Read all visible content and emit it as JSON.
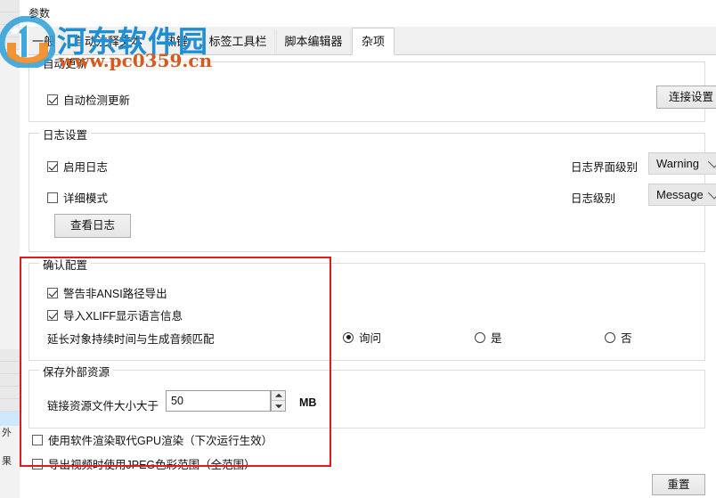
{
  "window": {
    "title": "参数"
  },
  "background_strip": {
    "rows": [
      "",
      "",
      "",
      "",
      "",
      "",
      "",
      "外",
      "果"
    ]
  },
  "tabs": [
    {
      "label": "一般",
      "active": false
    },
    {
      "label": "自动注释文本",
      "active": false
    },
    {
      "label": "热键",
      "active": false
    },
    {
      "label": "标签工具栏",
      "active": false
    },
    {
      "label": "脚本编辑器",
      "active": false
    },
    {
      "label": "杂项",
      "active": true
    }
  ],
  "auto_update": {
    "legend": "自动更新",
    "checkbox": {
      "label": "自动检测更新",
      "checked": true
    },
    "connection_button": "连接设置"
  },
  "log_settings": {
    "legend": "日志设置",
    "enable_log": {
      "label": "启用日志",
      "checked": true
    },
    "verbose_mode": {
      "label": "详细模式",
      "checked": false
    },
    "view_log_button": "查看日志",
    "ui_level_label": "日志界面级别",
    "ui_level_value": "Warning",
    "log_level_label": "日志级别",
    "log_level_value": "Message"
  },
  "confirm_config": {
    "legend": "确认配置",
    "warn_non_ansi": {
      "label": "警告非ANSI路径导出",
      "checked": true
    },
    "import_xliff": {
      "label": "导入XLIFF显示语言信息",
      "checked": true
    },
    "extend_duration_label": "延长对象持续时间与生成音频匹配",
    "radios": [
      {
        "label": "询问",
        "selected": true
      },
      {
        "label": "是",
        "selected": false
      },
      {
        "label": "否",
        "selected": false
      }
    ]
  },
  "external_resources": {
    "legend": "保存外部资源",
    "link_size_label": "链接资源文件大小大于",
    "link_size_value": "50",
    "unit": "MB"
  },
  "misc_options": {
    "software_render": {
      "label": "使用软件渲染取代GPU渲染（下次运行生效）",
      "checked": false
    },
    "jpeg_range": {
      "label": "导出视频时使用JPEG色彩范围（全范围）",
      "checked": false
    }
  },
  "footer": {
    "reset_button": "重置"
  },
  "watermark": {
    "title": "河东软件园",
    "url": "www.pc0359.cn",
    "title_color": "#1e8fd5",
    "url_color": "#d65a1e"
  },
  "highlight": {
    "color": "#e01b1b"
  }
}
